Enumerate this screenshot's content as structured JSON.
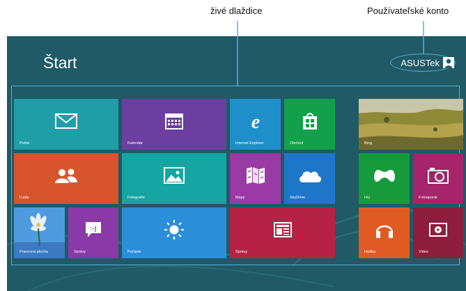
{
  "callouts": {
    "live_tiles": "živé dlaždice",
    "user_account": "Používateľské konto"
  },
  "screen": {
    "title": "Štart",
    "user_name": "ASUSTek",
    "background_color": "#1f5a66",
    "highlight_color": "#5ab0d6"
  },
  "tiles": [
    {
      "id": "mail",
      "label": "Pošta",
      "color": "#1f9ea8",
      "icon": "envelope-icon"
    },
    {
      "id": "calendar",
      "label": "Kalendár",
      "color": "#6b3fa0",
      "icon": "calendar-icon"
    },
    {
      "id": "ie",
      "label": "Internet Explorer",
      "color": "#1f8fc9",
      "icon": "internet-explorer-icon"
    },
    {
      "id": "store",
      "label": "Obchod",
      "color": "#13a04b",
      "icon": "store-bag-icon"
    },
    {
      "id": "bing",
      "label": "Bing",
      "color": "#8e8a3c",
      "icon": "landscape-photo"
    },
    {
      "id": "people",
      "label": "Ľudia",
      "color": "#d8542c",
      "icon": "people-icon"
    },
    {
      "id": "photos",
      "label": "Fotografie",
      "color": "#15a5a3",
      "icon": "picture-icon"
    },
    {
      "id": "maps",
      "label": "Mapy",
      "color": "#9a3aa5",
      "icon": "map-icon"
    },
    {
      "id": "skydrive",
      "label": "SkyDrive",
      "color": "#1e76c9",
      "icon": "cloud-icon"
    },
    {
      "id": "games",
      "label": "Hry",
      "color": "#169a3b",
      "icon": "game-controller-icon"
    },
    {
      "id": "camera",
      "label": "Fotoaparát",
      "color": "#a5246a",
      "icon": "camera-icon"
    },
    {
      "id": "desktop",
      "label": "Pracovná plocha",
      "color": "#3b8ad6",
      "icon": "desktop-wallpaper"
    },
    {
      "id": "messaging",
      "label": "Správy",
      "color": "#8a3aa6",
      "icon": "chat-bubble-icon"
    },
    {
      "id": "weather",
      "label": "Počasie",
      "color": "#2a8ed9",
      "icon": "sun-icon"
    },
    {
      "id": "news",
      "label": "Správy",
      "color": "#b52245",
      "icon": "newspaper-icon"
    },
    {
      "id": "music",
      "label": "Hudba",
      "color": "#e05a24",
      "icon": "headphones-icon"
    },
    {
      "id": "video",
      "label": "Video",
      "color": "#8d1e3e",
      "icon": "video-player-icon"
    }
  ]
}
